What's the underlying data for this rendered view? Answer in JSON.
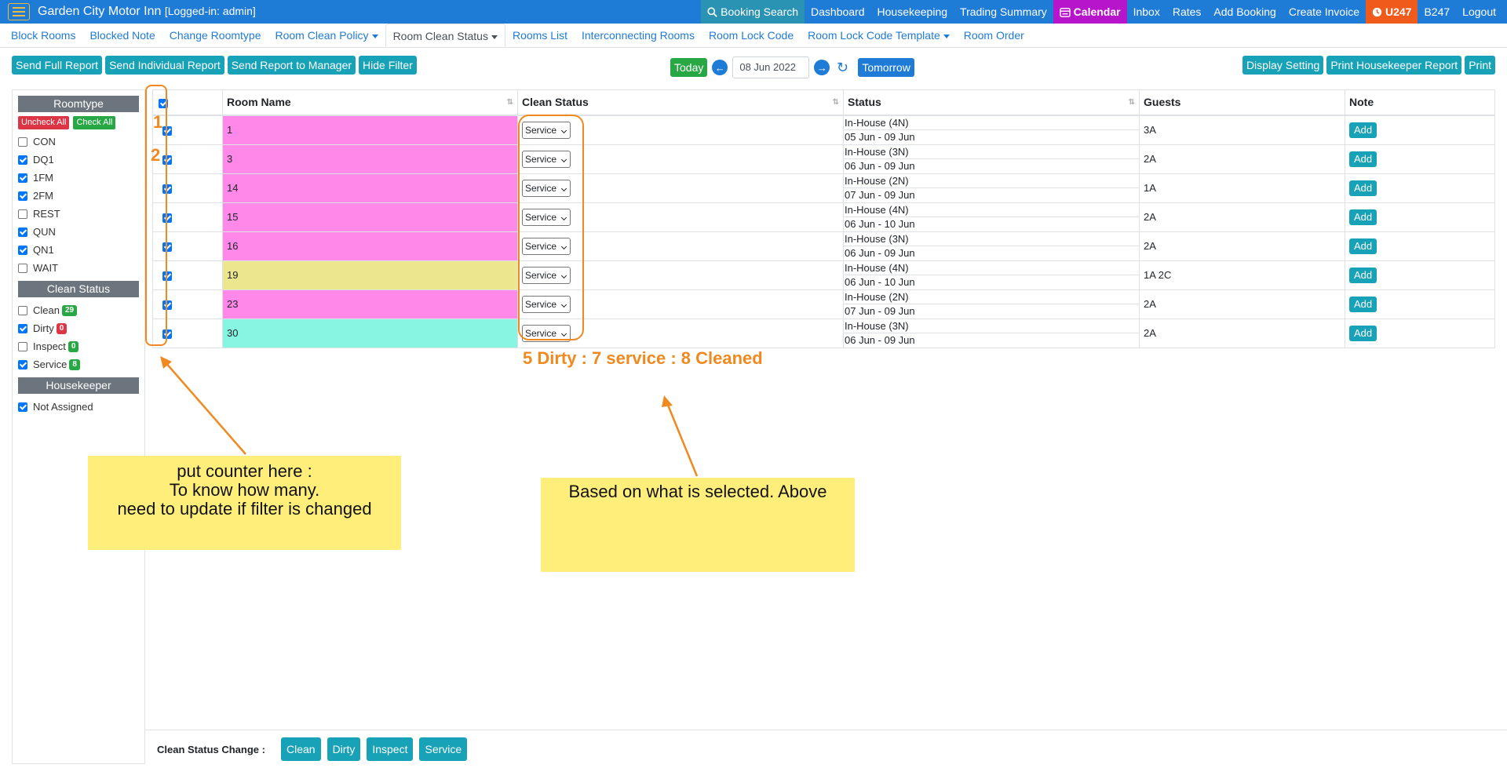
{
  "topbar": {
    "brand": "Garden City Motor Inn",
    "login": "[Logged-in: admin]",
    "items": [
      {
        "label": "Booking Search",
        "icon": "search-icon"
      },
      {
        "label": "Dashboard"
      },
      {
        "label": "Housekeeping"
      },
      {
        "label": "Trading Summary"
      },
      {
        "label": "Calendar",
        "icon": "calendar-icon"
      },
      {
        "label": "Inbox"
      },
      {
        "label": "Rates"
      },
      {
        "label": "Add Booking"
      },
      {
        "label": "Create Invoice"
      },
      {
        "label": "U247",
        "icon": "clock-icon"
      },
      {
        "label": "B247"
      },
      {
        "label": "Logout"
      }
    ]
  },
  "tabs": [
    {
      "label": "Block Rooms"
    },
    {
      "label": "Blocked Note"
    },
    {
      "label": "Change Roomtype"
    },
    {
      "label": "Room Clean Policy"
    },
    {
      "label": "Room Clean Status"
    },
    {
      "label": "Rooms List"
    },
    {
      "label": "Interconnecting Rooms"
    },
    {
      "label": "Room Lock Code"
    },
    {
      "label": "Room Lock Code Template"
    },
    {
      "label": "Room Order"
    }
  ],
  "actions": {
    "left": [
      "Send Full Report",
      "Send Individual Report",
      "Send Report to Manager",
      "Hide Filter"
    ],
    "right": [
      "Display Setting",
      "Print Housekeeper Report",
      "Print"
    ],
    "today": "Today",
    "date": "08 Jun 2022",
    "tomorrow": "Tomorrow"
  },
  "sidebar": {
    "roomtype_title": "Roomtype",
    "uncheck_all": "Uncheck All",
    "check_all": "Check All",
    "roomtypes": [
      {
        "label": "CON",
        "checked": false
      },
      {
        "label": "DQ1",
        "checked": true
      },
      {
        "label": "1FM",
        "checked": true
      },
      {
        "label": "2FM",
        "checked": true
      },
      {
        "label": "REST",
        "checked": false
      },
      {
        "label": "QUN",
        "checked": true
      },
      {
        "label": "QN1",
        "checked": true
      },
      {
        "label": "WAIT",
        "checked": false
      }
    ],
    "clean_title": "Clean Status",
    "clean": [
      {
        "label": "Clean",
        "checked": false,
        "count": "29",
        "color": "#28a745"
      },
      {
        "label": "Dirty",
        "checked": true,
        "count": "0",
        "color": "#dc3545"
      },
      {
        "label": "Inspect",
        "checked": false,
        "count": "0",
        "color": "#28a745"
      },
      {
        "label": "Service",
        "checked": true,
        "count": "8",
        "color": "#28a745"
      }
    ],
    "housekeeper_title": "Housekeeper",
    "housekeeper": [
      {
        "label": "Not Assigned",
        "checked": true
      }
    ]
  },
  "table": {
    "headers": [
      "Room Name",
      "Clean Status",
      "Status",
      "Guests",
      "Note"
    ],
    "add_label": "Add",
    "rows": [
      {
        "room": "1",
        "color": "#ff88e8",
        "clean": "Service",
        "status": "In-House (4N)",
        "dates": "05 Jun - 09 Jun",
        "guests": "3A"
      },
      {
        "room": "3",
        "color": "#ff88e8",
        "clean": "Service",
        "status": "In-House (3N)",
        "dates": "06 Jun - 09 Jun",
        "guests": "2A"
      },
      {
        "room": "14",
        "color": "#ff88e8",
        "clean": "Service",
        "status": "In-House (2N)",
        "dates": "07 Jun - 09 Jun",
        "guests": "1A"
      },
      {
        "room": "15",
        "color": "#ff88e8",
        "clean": "Service",
        "status": "In-House (4N)",
        "dates": "06 Jun - 10 Jun",
        "guests": "2A"
      },
      {
        "room": "16",
        "color": "#ff88e8",
        "clean": "Service",
        "status": "In-House (3N)",
        "dates": "06 Jun - 09 Jun",
        "guests": "2A"
      },
      {
        "room": "19",
        "color": "#ece68e",
        "clean": "Service",
        "status": "In-House (4N)",
        "dates": "06 Jun - 10 Jun",
        "guests": "1A 2C"
      },
      {
        "room": "23",
        "color": "#ff88e8",
        "clean": "Service",
        "status": "In-House (2N)",
        "dates": "07 Jun - 09 Jun",
        "guests": "2A"
      },
      {
        "room": "30",
        "color": "#88f5e3",
        "clean": "Service",
        "status": "In-House (3N)",
        "dates": "06 Jun - 09 Jun",
        "guests": "2A"
      }
    ]
  },
  "annotations": {
    "num1": "1",
    "num2": "2",
    "summary": "5 Dirty : 7 service : 8 Cleaned",
    "note1": [
      "put counter here :",
      "To know how many.",
      "need to update if filter is changed"
    ],
    "note2": "Based on what is selected. Above"
  },
  "footer": {
    "label": "Clean Status Change :",
    "buttons": [
      "Clean",
      "Dirty",
      "Inspect",
      "Service"
    ]
  },
  "colors": {
    "accent": "#1e7bd6",
    "annotation": "#f0891f",
    "note": "#ffef7a"
  }
}
